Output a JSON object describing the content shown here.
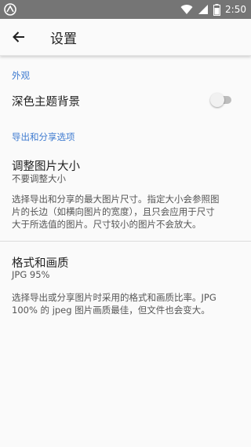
{
  "status_bar": {
    "time": "2:50"
  },
  "app_bar": {
    "title": "设置"
  },
  "sections": {
    "appearance": {
      "header": "外观",
      "dark_theme": {
        "title": "深色主题背景",
        "enabled": false
      }
    },
    "export": {
      "header": "导出和分享选项",
      "resize": {
        "title": "调整图片大小",
        "value": "不要调整大小",
        "description_lines": [
          "选择导出和分享的最大图片尺寸。指定大小会参照图",
          "片的长边（如横向图片的宽度），且只会应用于尺寸",
          "大于所选值的图片。尺寸较小的图片不会放大。"
        ]
      },
      "format": {
        "title": "格式和画质",
        "value": "JPG 95%",
        "description_lines": [
          "选择导出或分享图片时采用的格式和画质比率。JPG",
          "100% 的 jpeg 图片画质最佳，但文件也会变大。"
        ]
      }
    }
  },
  "colors": {
    "accent": "#3f7bd0",
    "status_bar": "#757575"
  },
  "icons": [
    "app-logo-icon",
    "wifi-icon",
    "signal-icon",
    "battery-icon",
    "back-arrow-icon"
  ]
}
